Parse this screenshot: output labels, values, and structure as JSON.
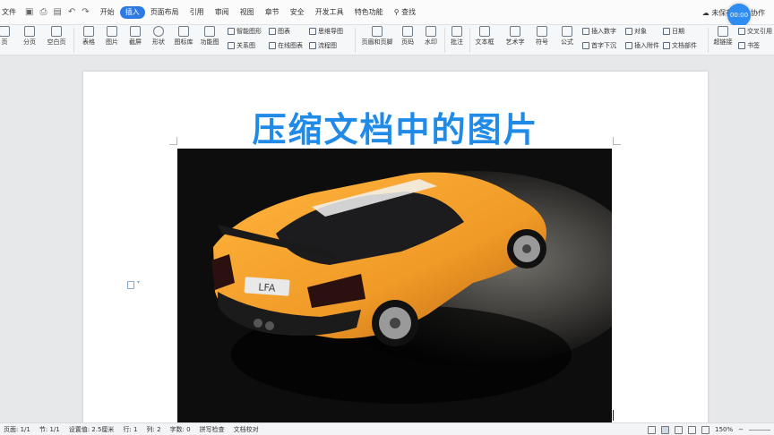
{
  "menubar": {
    "file_label": "文件",
    "tabs": [
      {
        "label": "开始"
      },
      {
        "label": "插入"
      },
      {
        "label": "页面布局"
      },
      {
        "label": "引用"
      },
      {
        "label": "审阅"
      },
      {
        "label": "视图"
      },
      {
        "label": "章节"
      },
      {
        "label": "安全"
      },
      {
        "label": "开发工具"
      },
      {
        "label": "特色功能"
      }
    ],
    "active_tab": "插入",
    "search_label": "查找",
    "unsaved_label": "未保存",
    "collab_label": "协作",
    "timer_text": "00:00",
    "accent_color": "#2e7ae5"
  },
  "ribbon": {
    "items": [
      {
        "label": "页"
      },
      {
        "label": "分页"
      },
      {
        "label": "空白页"
      },
      {
        "label": "表格"
      },
      {
        "label": "图片"
      },
      {
        "label": "截屏"
      },
      {
        "label": "形状"
      },
      {
        "label": "图标库"
      },
      {
        "label": "功能图"
      },
      {
        "label": "页眉和页脚"
      },
      {
        "label": "页码"
      },
      {
        "label": "水印"
      },
      {
        "label": "批注"
      },
      {
        "label": "文本框"
      },
      {
        "label": "艺术字"
      },
      {
        "label": "符号"
      },
      {
        "label": "公式"
      },
      {
        "label": "超链接"
      },
      {
        "label": "书签"
      }
    ],
    "small_items": [
      {
        "label": "智能图形"
      },
      {
        "label": "图表"
      },
      {
        "label": "思维导图"
      },
      {
        "label": "关系图"
      },
      {
        "label": "在线图表"
      },
      {
        "label": "流程图"
      },
      {
        "label": "插入数字"
      },
      {
        "label": "对象"
      },
      {
        "label": "日期"
      },
      {
        "label": "首字下沉"
      },
      {
        "label": "插入附件"
      },
      {
        "label": "文档部件"
      },
      {
        "label": "交叉引用"
      }
    ]
  },
  "document": {
    "title": "压缩文档中的图片",
    "title_color": "#1f8ae8",
    "plate_text": "LFA",
    "car_color": "#f09a27"
  },
  "statusbar": {
    "items": [
      {
        "label": "页面: 1/1"
      },
      {
        "label": "节: 1/1"
      },
      {
        "label": "设置值: 2.5厘米"
      },
      {
        "label": "行: 1"
      },
      {
        "label": "列: 2"
      },
      {
        "label": "字数: 0"
      },
      {
        "label": "拼写检查"
      },
      {
        "label": "文档校对"
      }
    ],
    "zoom": "150%"
  }
}
